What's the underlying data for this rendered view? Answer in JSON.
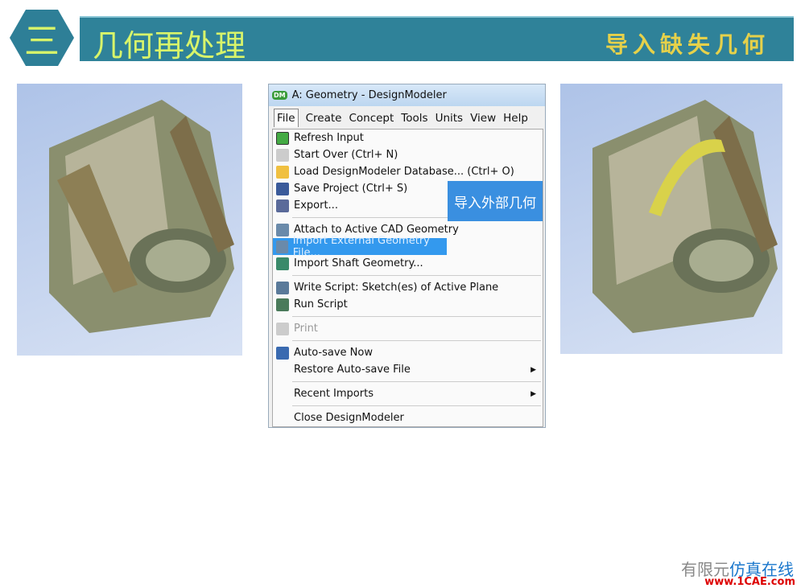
{
  "slide": {
    "section_number": "三",
    "title": "几何再处理",
    "subtitle": "导入缺失几何"
  },
  "window": {
    "app_icon": "DM",
    "title": "A: Geometry - DesignModeler"
  },
  "menubar": [
    "File",
    "Create",
    "Concept",
    "Tools",
    "Units",
    "View",
    "Help"
  ],
  "file_menu": [
    {
      "label": "Refresh Input",
      "icon": "refresh-icon"
    },
    {
      "label": "Start Over (Ctrl+ N)",
      "icon": "start-over-icon"
    },
    {
      "label": "Load DesignModeler Database... (Ctrl+ O)",
      "icon": "folder-open-icon"
    },
    {
      "label": "Save Project (Ctrl+ S)",
      "icon": "save-icon"
    },
    {
      "label": "Export...",
      "icon": "export-icon"
    },
    {
      "label": "Attach to Active CAD Geometry",
      "icon": "attach-cad-icon"
    },
    {
      "label": "Import External Geometry File...",
      "icon": "import-geometry-icon",
      "highlighted": true
    },
    {
      "label": "Import Shaft Geometry...",
      "icon": "shaft-icon"
    },
    {
      "label": "Write Script: Sketch(es) of Active Plane",
      "icon": "write-script-icon"
    },
    {
      "label": "Run Script",
      "icon": "run-script-icon"
    },
    {
      "label": "Print",
      "icon": "print-icon",
      "disabled": true
    },
    {
      "label": "Auto-save Now",
      "icon": "autosave-icon"
    },
    {
      "label": "Restore Auto-save File",
      "submenu": true
    },
    {
      "label": "Recent Imports",
      "submenu": true
    },
    {
      "label": "Close DesignModeler"
    }
  ],
  "callout": "导入外部几何",
  "watermark": {
    "text1": "有限元",
    "text2": "仿真在线",
    "url": "www.1CAE.com"
  },
  "colors": {
    "banner": "#2f8299",
    "title": "#d8f46a",
    "highlight": "#3399ee"
  }
}
